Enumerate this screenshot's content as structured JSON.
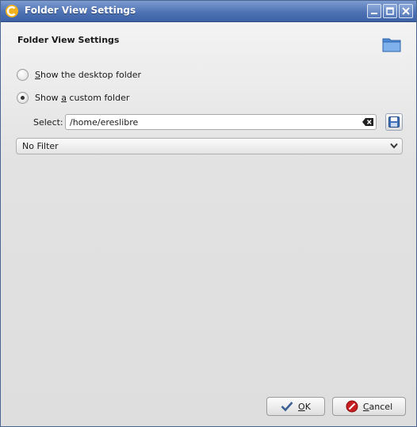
{
  "window": {
    "title": "Folder View Settings"
  },
  "titlebar_buttons": {
    "minimize": "minimize-icon",
    "maximize": "maximize-icon",
    "close": "close-icon"
  },
  "header": {
    "title": "Folder View Settings",
    "icon": "folder-icon"
  },
  "options": {
    "desktop": {
      "accel": "S",
      "rest": "how the desktop folder",
      "checked": false
    },
    "custom": {
      "prefix": "Show ",
      "accel": "a",
      "rest": " custom folder",
      "checked": true
    }
  },
  "select": {
    "label": "Select:",
    "value": "/home/ereslibre"
  },
  "filter": {
    "value": "No Filter"
  },
  "buttons": {
    "ok": {
      "accel": "O",
      "rest": "K",
      "icon": "checkmark-icon"
    },
    "cancel": {
      "accel": "C",
      "rest": "ancel",
      "icon": "cancel-icon"
    }
  }
}
